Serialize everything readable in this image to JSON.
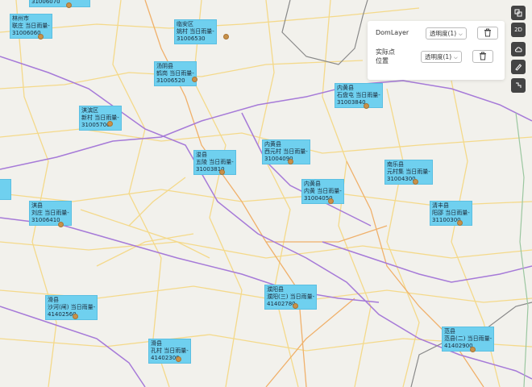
{
  "stations": [
    {
      "lines": [
        "31006070"
      ]
    },
    {
      "lines": [
        "林州市",
        "联庄  当日雨量-",
        "31006060"
      ]
    },
    {
      "lines": [
        "临安区",
        "姚村  当日雨量-",
        "31006530"
      ]
    },
    {
      "lines": [
        "汤阴县",
        "鹤岗  当日雨量-",
        "31006520"
      ]
    },
    {
      "lines": [
        "内黄县",
        "石盘屯  当日雨量-",
        "31003840"
      ]
    },
    {
      "lines": [
        "淇滨区",
        "新村  当日雨量-",
        "31005700"
      ]
    },
    {
      "lines": [
        "浚县",
        "五陵  当日雨量-",
        "31003810"
      ]
    },
    {
      "lines": [
        "内黄县",
        "西元村  当日雨量-",
        "31004090"
      ]
    },
    {
      "lines": [
        "南乐县",
        "元村集  当日雨量-",
        "31004300"
      ]
    },
    {
      "lines": [
        "内黄县",
        "内黄  当日雨量-",
        "31004050"
      ]
    },
    {
      "lines": [
        "清丰县",
        "阳邵  当日雨量-",
        "31100300"
      ]
    },
    {
      "lines": [
        "淇县",
        "刘庄  当日雨量-",
        "31006410"
      ]
    },
    {
      "lines": [
        "濮阳县",
        "濮阳(三)  当日雨量-",
        "41402780"
      ]
    },
    {
      "lines": [
        "滑县",
        "沙河(闸)  当日雨量-",
        "41402560"
      ]
    },
    {
      "lines": [
        "范县",
        "范县(二)  当日雨量-",
        "41402900"
      ]
    },
    {
      "lines": [
        "滑县",
        "孔村  当日雨量-",
        "41402300"
      ]
    }
  ],
  "layer_panel": {
    "rows": [
      {
        "name": "DomLayer",
        "opacity_label": "透明度(1)"
      },
      {
        "name_line1": "实际点",
        "name_line2": "位置",
        "opacity_label": "透明度(1)"
      }
    ]
  },
  "toolbar": {
    "view_2d_label": "2D"
  },
  "icons": [
    "layers-icon",
    "cloud-icon",
    "pen-icon",
    "ruler-icon",
    "trash-icon",
    "chevron-down-icon"
  ]
}
